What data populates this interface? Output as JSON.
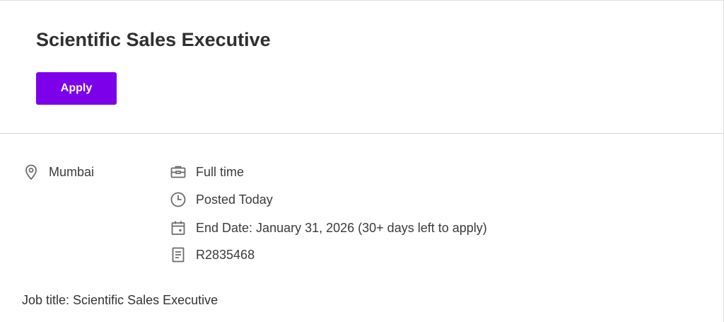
{
  "header": {
    "title": "Scientific Sales Executive",
    "apply_label": "Apply",
    "accent_color": "#7d00eb"
  },
  "details": {
    "location": {
      "icon": "location-pin-icon",
      "text": "Mumbai"
    },
    "job_type": {
      "icon": "briefcase-icon",
      "text": "Full time"
    },
    "posted": {
      "icon": "clock-icon",
      "text": "Posted Today"
    },
    "end_date": {
      "icon": "calendar-icon",
      "text": "End Date: January 31, 2026 (30+ days left to apply)"
    },
    "requisition_id": {
      "icon": "document-icon",
      "text": "R2835468"
    }
  },
  "description": {
    "job_title_line": "Job title: Scientific Sales Executive"
  }
}
